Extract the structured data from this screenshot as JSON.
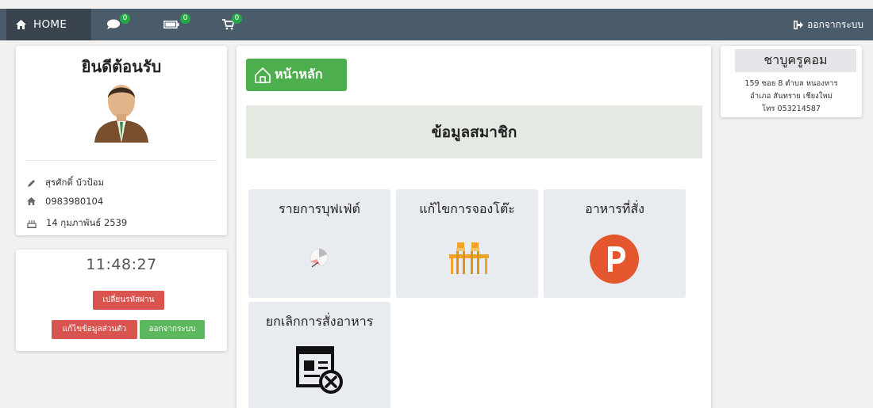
{
  "navbar": {
    "home_label": "HOME",
    "chat_count": "0",
    "card_count": "0",
    "cart_count": "0",
    "logout_label": "ออกจากระบบ"
  },
  "profile": {
    "welcome": "ยินดีต้อนรับ",
    "name": "สุรศักดิ์ บัวป้อม",
    "phone": "0983980104",
    "birthdate": "14 กุมภาพันธ์ 2539"
  },
  "clock": {
    "time": "11:48:27",
    "change_password_label": "เปลี่ยนรหัสผ่าน",
    "edit_profile_label": "แก้ไขข้อมูลส่วนตัว",
    "logout_label": "ออกจากระบบ"
  },
  "main": {
    "home_button_label": "หน้าหลัก",
    "section_title": "ข้อมูลสมาชิก",
    "tiles": [
      {
        "label": "รายการบุฟเฟ่ต์",
        "icon": "buffet-icon"
      },
      {
        "label": "แก้ไขการจองโต๊ะ",
        "icon": "table-chairs-icon"
      },
      {
        "label": "อาหารที่สั่ง",
        "icon": "p-circle-icon"
      },
      {
        "label": "ยกเลิกการสั่งอาหาร",
        "icon": "cancel-order-icon"
      }
    ]
  },
  "shop": {
    "name": "ชาบูครูคอม",
    "address_line1": "159 ซอย 8 ตำบล หนองหาร",
    "address_line2": "อำเภอ สันทราย เชียงใหม่",
    "phone_line": "โทร 053214587"
  },
  "colors": {
    "navbar": "#4a5b6a",
    "home_active": "#39444f",
    "badge": "#28a745",
    "danger": "#d9534f",
    "success": "#5cb85c",
    "p_icon": "#e4572e"
  }
}
